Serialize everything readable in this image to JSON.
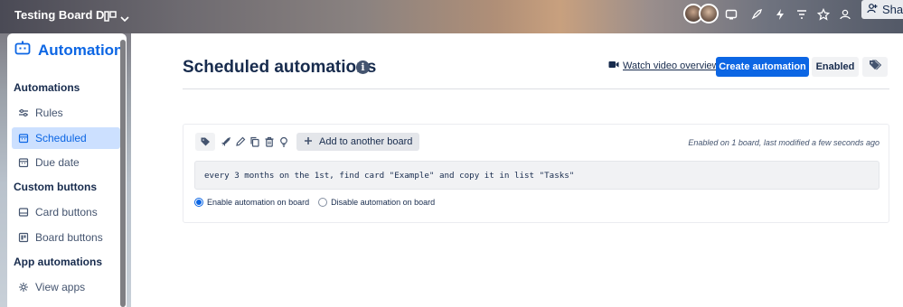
{
  "colors": {
    "accent": "#0c66e4",
    "active_bg": "#cce0ff",
    "text": "#172b4d",
    "muted": "#44546f"
  },
  "header": {
    "board_name": "Testing Board D",
    "share_label": "Shar",
    "icons": [
      "board-view-icon",
      "chevron-down-icon",
      "power-up-icon",
      "rocket-icon",
      "automation-bolt-icon",
      "filter-icon",
      "star-icon",
      "people-icon",
      "add-person-icon"
    ]
  },
  "sidebar": {
    "title": "Automation",
    "sections": [
      {
        "label": "Automations",
        "items": [
          {
            "label": "Rules",
            "icon": "sliders-icon",
            "active": false
          },
          {
            "label": "Scheduled",
            "icon": "calendar-icon",
            "active": true
          },
          {
            "label": "Due date",
            "icon": "calendar-icon",
            "active": false
          }
        ]
      },
      {
        "label": "Custom buttons",
        "items": [
          {
            "label": "Card buttons",
            "icon": "card-icon",
            "active": false
          },
          {
            "label": "Board buttons",
            "icon": "board-icon",
            "active": false
          }
        ]
      },
      {
        "label": "App automations",
        "items": [
          {
            "label": "View apps",
            "icon": "gear-icon",
            "active": false
          }
        ]
      }
    ]
  },
  "main": {
    "title": "Scheduled automations",
    "watch_video": "Watch video overview",
    "create_button": "Create automation",
    "enabled_button": "Enabled",
    "card": {
      "add_board_label": "Add to another board",
      "meta": "Enabled on 1 board, last modified a few seconds ago",
      "rule_text": "every 3 months on the 1st, find card \"Example\" and copy it in list \"Tasks\"",
      "radio_enable": "Enable automation on board",
      "radio_disable": "Disable automation on board",
      "enabled": true
    }
  }
}
